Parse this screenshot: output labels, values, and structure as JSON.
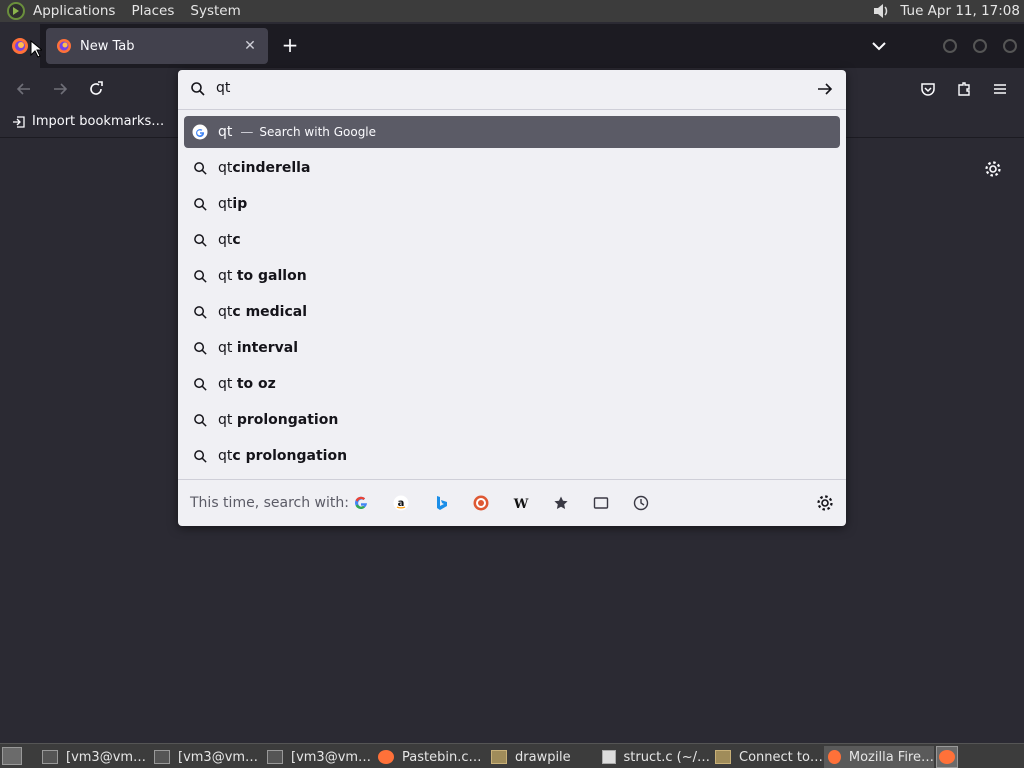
{
  "top_panel": {
    "menus": [
      "Applications",
      "Places",
      "System"
    ],
    "clock": "Tue Apr 11, 17:08"
  },
  "browser": {
    "tab_title": "New Tab",
    "bookmark_label": "Import bookmarks…"
  },
  "urlbar": {
    "query": "qt",
    "heuristic": {
      "prefix": "qt",
      "dash": "—",
      "action": "Search with Google"
    },
    "suggestions": [
      {
        "typed": "qt",
        "rest": "cinderella"
      },
      {
        "typed": "qt",
        "rest": "ip"
      },
      {
        "typed": "qt",
        "rest": "c"
      },
      {
        "typed": "qt ",
        "rest": "to gallon"
      },
      {
        "typed": "qt",
        "rest": "c medical"
      },
      {
        "typed": "qt ",
        "rest": "interval"
      },
      {
        "typed": "qt ",
        "rest": "to oz"
      },
      {
        "typed": "qt ",
        "rest": "prolongation"
      },
      {
        "typed": "qt",
        "rest": "c prolongation"
      }
    ],
    "footer_label": "This time, search with:",
    "engines": [
      "google-icon",
      "amazon-icon",
      "bing-icon",
      "duckduckgo-icon",
      "wikipedia-icon",
      "bookmarks-icon",
      "tabs-icon",
      "history-icon"
    ]
  },
  "taskbar": {
    "tasks": [
      "[vm3@vm…",
      "[vm3@vm…",
      "[vm3@vm…",
      "Pastebin.c…",
      "drawpile",
      "struct.c (~/…",
      "Connect to…",
      "Mozilla Fire…"
    ]
  }
}
